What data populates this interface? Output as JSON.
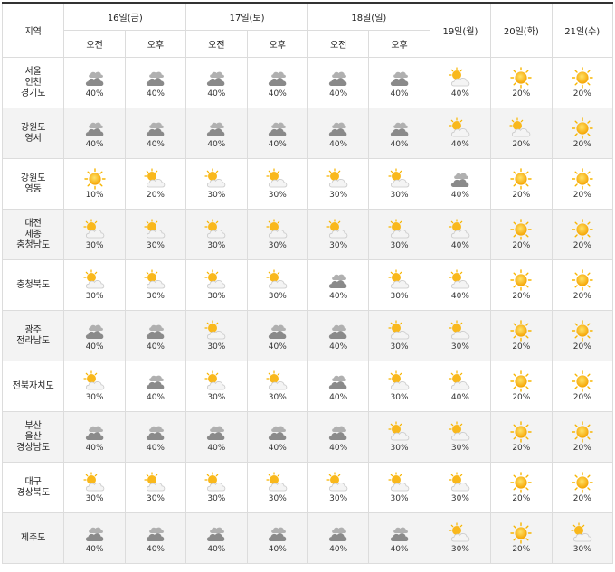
{
  "header": {
    "region_label": "지역",
    "days_split": [
      {
        "label": "16일(금)",
        "am": "오전",
        "pm": "오후"
      },
      {
        "label": "17일(토)",
        "am": "오전",
        "pm": "오후"
      },
      {
        "label": "18일(일)",
        "am": "오전",
        "pm": "오후"
      }
    ],
    "days_single": [
      "19일(월)",
      "20일(화)",
      "21일(수)"
    ]
  },
  "icon_legend": {
    "cloudy": "cloudy-icon",
    "partly": "partly-cloudy-icon",
    "sunny": "sunny-icon"
  },
  "rows": [
    {
      "region": [
        "서울",
        "인천",
        "경기도"
      ],
      "cells": [
        {
          "icon": "cloudy",
          "pct": "40%"
        },
        {
          "icon": "cloudy",
          "pct": "40%"
        },
        {
          "icon": "cloudy",
          "pct": "40%"
        },
        {
          "icon": "cloudy",
          "pct": "40%"
        },
        {
          "icon": "cloudy",
          "pct": "40%"
        },
        {
          "icon": "cloudy",
          "pct": "40%"
        },
        {
          "icon": "partly",
          "pct": "40%"
        },
        {
          "icon": "sunny",
          "pct": "20%"
        },
        {
          "icon": "sunny",
          "pct": "20%"
        }
      ]
    },
    {
      "region": [
        "강원도",
        "영서"
      ],
      "cells": [
        {
          "icon": "cloudy",
          "pct": "40%"
        },
        {
          "icon": "cloudy",
          "pct": "40%"
        },
        {
          "icon": "cloudy",
          "pct": "40%"
        },
        {
          "icon": "cloudy",
          "pct": "40%"
        },
        {
          "icon": "cloudy",
          "pct": "40%"
        },
        {
          "icon": "cloudy",
          "pct": "40%"
        },
        {
          "icon": "partly",
          "pct": "40%"
        },
        {
          "icon": "partly",
          "pct": "20%"
        },
        {
          "icon": "sunny",
          "pct": "20%"
        }
      ]
    },
    {
      "region": [
        "강원도",
        "영동"
      ],
      "cells": [
        {
          "icon": "sunny",
          "pct": "10%"
        },
        {
          "icon": "partly",
          "pct": "20%"
        },
        {
          "icon": "partly",
          "pct": "30%"
        },
        {
          "icon": "partly",
          "pct": "30%"
        },
        {
          "icon": "partly",
          "pct": "30%"
        },
        {
          "icon": "partly",
          "pct": "30%"
        },
        {
          "icon": "cloudy",
          "pct": "40%"
        },
        {
          "icon": "sunny",
          "pct": "20%"
        },
        {
          "icon": "sunny",
          "pct": "20%"
        }
      ]
    },
    {
      "region": [
        "대전",
        "세종",
        "충청남도"
      ],
      "cells": [
        {
          "icon": "partly",
          "pct": "30%"
        },
        {
          "icon": "partly",
          "pct": "30%"
        },
        {
          "icon": "partly",
          "pct": "30%"
        },
        {
          "icon": "partly",
          "pct": "30%"
        },
        {
          "icon": "partly",
          "pct": "30%"
        },
        {
          "icon": "partly",
          "pct": "30%"
        },
        {
          "icon": "partly",
          "pct": "40%"
        },
        {
          "icon": "sunny",
          "pct": "20%"
        },
        {
          "icon": "sunny",
          "pct": "20%"
        }
      ]
    },
    {
      "region": [
        "충청북도"
      ],
      "cells": [
        {
          "icon": "partly",
          "pct": "30%"
        },
        {
          "icon": "partly",
          "pct": "30%"
        },
        {
          "icon": "partly",
          "pct": "30%"
        },
        {
          "icon": "partly",
          "pct": "30%"
        },
        {
          "icon": "cloudy",
          "pct": "40%"
        },
        {
          "icon": "partly",
          "pct": "30%"
        },
        {
          "icon": "partly",
          "pct": "40%"
        },
        {
          "icon": "sunny",
          "pct": "20%"
        },
        {
          "icon": "sunny",
          "pct": "20%"
        }
      ]
    },
    {
      "region": [
        "광주",
        "전라남도"
      ],
      "cells": [
        {
          "icon": "cloudy",
          "pct": "40%"
        },
        {
          "icon": "cloudy",
          "pct": "40%"
        },
        {
          "icon": "partly",
          "pct": "30%"
        },
        {
          "icon": "cloudy",
          "pct": "40%"
        },
        {
          "icon": "cloudy",
          "pct": "40%"
        },
        {
          "icon": "partly",
          "pct": "30%"
        },
        {
          "icon": "partly",
          "pct": "30%"
        },
        {
          "icon": "sunny",
          "pct": "20%"
        },
        {
          "icon": "sunny",
          "pct": "20%"
        }
      ]
    },
    {
      "region": [
        "전북자치도"
      ],
      "cells": [
        {
          "icon": "partly",
          "pct": "30%"
        },
        {
          "icon": "cloudy",
          "pct": "40%"
        },
        {
          "icon": "partly",
          "pct": "30%"
        },
        {
          "icon": "partly",
          "pct": "30%"
        },
        {
          "icon": "cloudy",
          "pct": "40%"
        },
        {
          "icon": "partly",
          "pct": "30%"
        },
        {
          "icon": "partly",
          "pct": "40%"
        },
        {
          "icon": "sunny",
          "pct": "20%"
        },
        {
          "icon": "sunny",
          "pct": "20%"
        }
      ]
    },
    {
      "region": [
        "부산",
        "울산",
        "경상남도"
      ],
      "cells": [
        {
          "icon": "cloudy",
          "pct": "40%"
        },
        {
          "icon": "cloudy",
          "pct": "40%"
        },
        {
          "icon": "cloudy",
          "pct": "40%"
        },
        {
          "icon": "cloudy",
          "pct": "40%"
        },
        {
          "icon": "cloudy",
          "pct": "40%"
        },
        {
          "icon": "partly",
          "pct": "30%"
        },
        {
          "icon": "partly",
          "pct": "30%"
        },
        {
          "icon": "sunny",
          "pct": "20%"
        },
        {
          "icon": "sunny",
          "pct": "20%"
        }
      ]
    },
    {
      "region": [
        "대구",
        "경상북도"
      ],
      "cells": [
        {
          "icon": "partly",
          "pct": "30%"
        },
        {
          "icon": "partly",
          "pct": "30%"
        },
        {
          "icon": "partly",
          "pct": "30%"
        },
        {
          "icon": "partly",
          "pct": "30%"
        },
        {
          "icon": "partly",
          "pct": "30%"
        },
        {
          "icon": "partly",
          "pct": "30%"
        },
        {
          "icon": "partly",
          "pct": "30%"
        },
        {
          "icon": "sunny",
          "pct": "20%"
        },
        {
          "icon": "sunny",
          "pct": "20%"
        }
      ]
    },
    {
      "region": [
        "제주도"
      ],
      "cells": [
        {
          "icon": "cloudy",
          "pct": "40%"
        },
        {
          "icon": "cloudy",
          "pct": "40%"
        },
        {
          "icon": "cloudy",
          "pct": "40%"
        },
        {
          "icon": "cloudy",
          "pct": "40%"
        },
        {
          "icon": "cloudy",
          "pct": "40%"
        },
        {
          "icon": "cloudy",
          "pct": "40%"
        },
        {
          "icon": "partly",
          "pct": "30%"
        },
        {
          "icon": "sunny",
          "pct": "20%"
        },
        {
          "icon": "partly",
          "pct": "30%"
        }
      ]
    }
  ]
}
